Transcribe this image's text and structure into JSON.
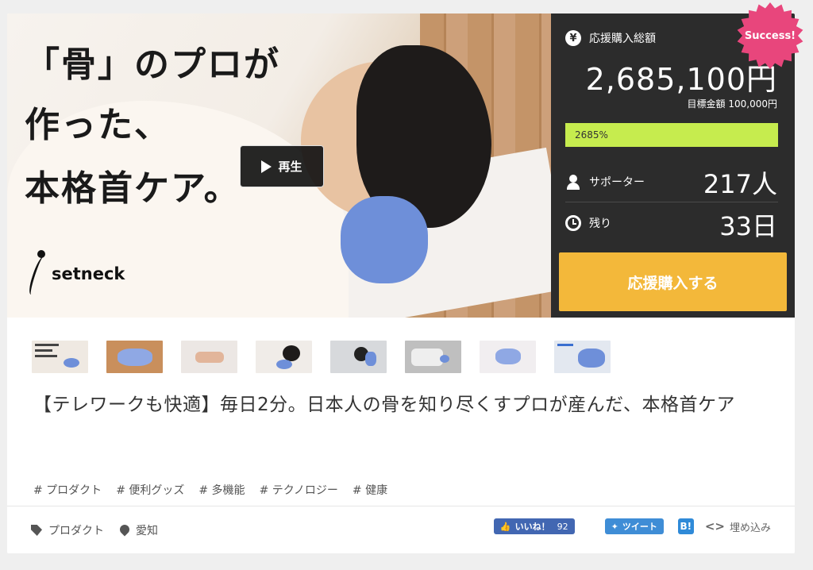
{
  "hero": {
    "headline_line1": "「骨」のプロが",
    "headline_line2": "作った、",
    "headline_line3": "本格首ケア。",
    "logo_text": "setneck",
    "play_label": "再生"
  },
  "stats": {
    "total_label": "応援購入総額",
    "total_value": "2,685,100円",
    "goal_text": "目標金額 100,000円",
    "progress_text": "2685%",
    "progress_fraction": 1.0,
    "supporters_label": "サポーター",
    "supporters_value": "217人",
    "remaining_label": "残り",
    "remaining_value": "33日",
    "support_button": "応援購入する",
    "badge": "Success!",
    "yen_symbol": "¥"
  },
  "thumbnails": [
    {
      "name": "thumb-1",
      "bg": "#efe9e2"
    },
    {
      "name": "thumb-2",
      "bg": "#c98f5c"
    },
    {
      "name": "thumb-3",
      "bg": "#ece7e4"
    },
    {
      "name": "thumb-4",
      "bg": "#f0ece8"
    },
    {
      "name": "thumb-5",
      "bg": "#d7d9dc"
    },
    {
      "name": "thumb-6",
      "bg": "#bfbfbf"
    },
    {
      "name": "thumb-7",
      "bg": "#f1eef0"
    },
    {
      "name": "thumb-8",
      "bg": "#e3e8f0"
    }
  ],
  "project_title": "【テレワークも快適】毎日2分。日本人の骨を知り尽くすプロが産んだ、本格首ケア",
  "tags": [
    "# プロダクト",
    "# 便利グッズ",
    "# 多機能",
    "# テクノロジー",
    "# 健康"
  ],
  "meta": {
    "category": "プロダクト",
    "location": "愛知"
  },
  "social": {
    "fb_label": "いいね！",
    "fb_count": "92",
    "tweet_label": "ツイート",
    "hatena_label": "B!",
    "embed_code": "<>",
    "embed_label": "埋め込み"
  },
  "colors": {
    "progress": "#c6ec4e",
    "support_button": "#f3b83a",
    "stats_bg": "#2c2c2c",
    "badge": "#e8467c",
    "facebook": "#4267b2",
    "twitter": "#3f8dd6"
  }
}
